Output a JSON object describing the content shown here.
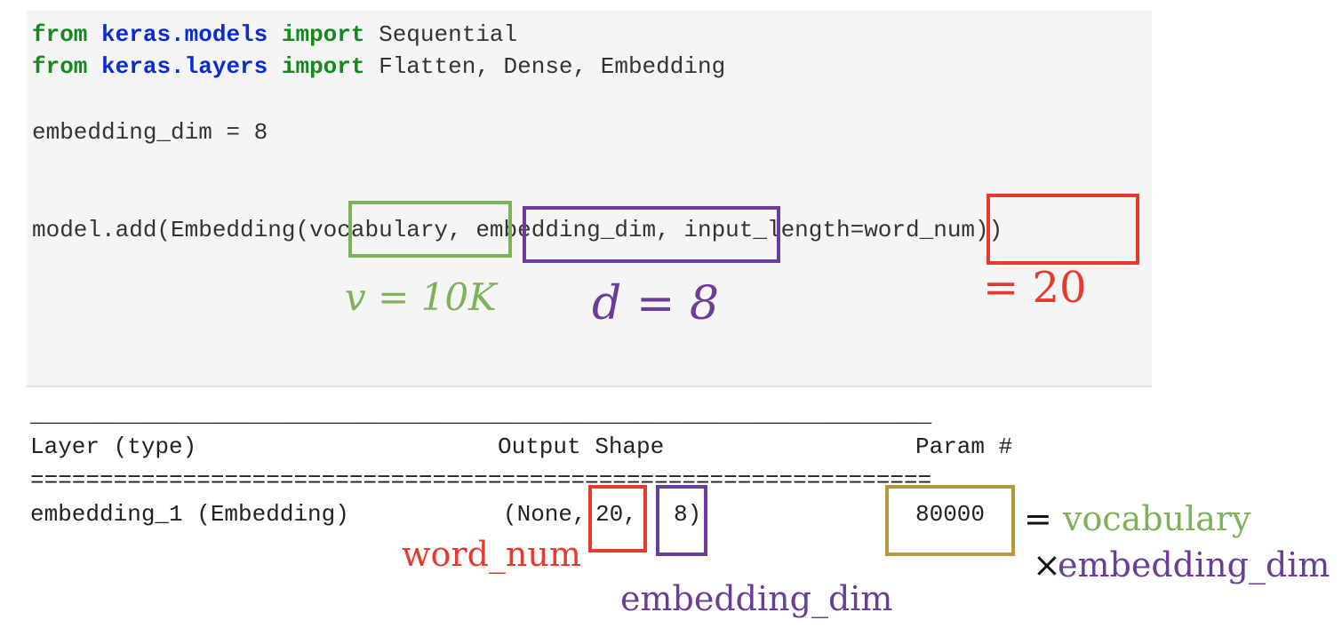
{
  "code": {
    "line1": {
      "kw_from": "from",
      "module": "keras.models",
      "kw_import": "import",
      "names": " Sequential"
    },
    "line2": {
      "kw_from": "from",
      "module": "keras.layers",
      "kw_import": "import",
      "names": " Flatten, Dense, Embedding"
    },
    "line3": "embedding_dim = 8",
    "line4": {
      "prefix": "model.add(Embedding(",
      "arg_vocab": "vocabulary",
      "sep1": ", ",
      "arg_dim": "embedding_dim,",
      "sep2": " ",
      "arg_input_kw": "input_length=",
      "arg_word": "word_num",
      "suffix": "))"
    }
  },
  "annotations": {
    "v_label": "v = 10K",
    "d_label": "d = 8",
    "wordnum_label": "= 20",
    "out_wordnum": "word_num",
    "out_embdim": "embedding_dim",
    "param_eq": "=",
    "param_vocab": "vocabulary",
    "param_times": "×",
    "param_embdim": "embedding_dim"
  },
  "summary": {
    "rule_top": "_________________________________________________________________",
    "header_layer": "Layer (type)",
    "header_output": "Output Shape",
    "header_param": "Param #",
    "rule_eq": "=================================================================",
    "row_layer": "embedding_1 (Embedding)",
    "row_out_open": "(None,",
    "row_out_20": "20,",
    "row_out_8": "8)",
    "row_param": "80000"
  },
  "colors": {
    "green": "#7fb05a",
    "purple": "#6a3d9a",
    "red": "#e63a2e",
    "gold": "#b8963a",
    "code_bg": "#f5f5f5"
  }
}
